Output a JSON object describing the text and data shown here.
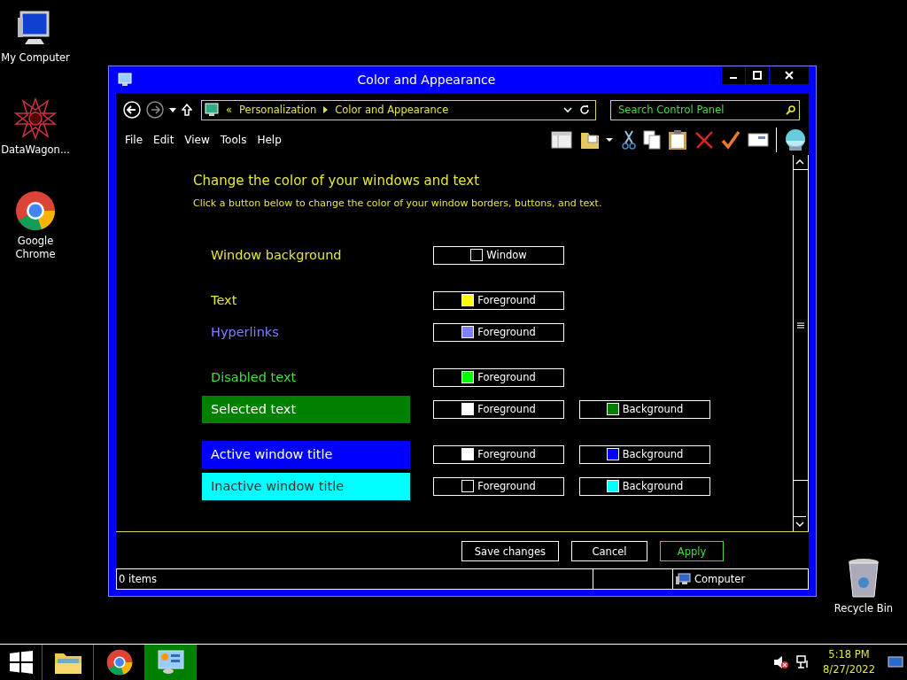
{
  "desktop_icons": [
    {
      "label": "My Computer",
      "kind": "computer"
    },
    {
      "label": "DataWagon...",
      "kind": "star"
    },
    {
      "label": "Google Chrome",
      "kind": "chrome"
    },
    {
      "label": "Recycle Bin",
      "kind": "bin"
    }
  ],
  "window": {
    "title": "Color and Appearance"
  },
  "address": {
    "crumbs": [
      "«",
      "Personalization",
      "Color and Appearance"
    ]
  },
  "search": {
    "placeholder": "Search Control Panel"
  },
  "menu": [
    "File",
    "Edit",
    "View",
    "Tools",
    "Help"
  ],
  "heading": "Change the color of your windows and text",
  "subheading": "Click a button below to change the color of your window borders, buttons, and text.",
  "groups": [
    {
      "rows": [
        {
          "label": "Window background",
          "kind": "plain",
          "color": "#e6e63a",
          "swatches": [
            {
              "label": "Window",
              "color": "#000000"
            }
          ]
        }
      ]
    },
    {
      "rows": [
        {
          "label": "Text",
          "kind": "plain",
          "color": "#e6e63a",
          "swatches": [
            {
              "label": "Foreground",
              "color": "#ffff00"
            }
          ]
        },
        {
          "label": "Hyperlinks",
          "kind": "plain",
          "color": "#8080ff",
          "swatches": [
            {
              "label": "Foreground",
              "color": "#8080ff"
            }
          ]
        }
      ]
    },
    {
      "rows": [
        {
          "label": "Disabled text",
          "kind": "plain",
          "color": "#3fdf3f",
          "swatches": [
            {
              "label": "Foreground",
              "color": "#00ff00"
            }
          ]
        },
        {
          "label": "Selected text",
          "kind": "band",
          "color": "#008000",
          "swatches": [
            {
              "label": "Foreground",
              "color": "#ffffff"
            },
            {
              "label": "Background",
              "color": "#008000"
            }
          ]
        }
      ]
    },
    {
      "rows": [
        {
          "label": "Active window title",
          "kind": "band",
          "color": "#0000ff",
          "swatches": [
            {
              "label": "Foreground",
              "color": "#ffffff"
            },
            {
              "label": "Background",
              "color": "#0000ff"
            }
          ]
        },
        {
          "label": "Inactive window title",
          "kind": "band",
          "color": "#00ffff",
          "swatches": [
            {
              "label": "Foreground",
              "color": "#000000"
            },
            {
              "label": "Background",
              "color": "#00ffff"
            }
          ]
        }
      ]
    }
  ],
  "buttons": [
    {
      "label": "Save changes",
      "kind": "normal"
    },
    {
      "label": "Cancel",
      "kind": "normal"
    },
    {
      "label": "Apply",
      "kind": "accent"
    }
  ],
  "status_bar": {
    "items": "0 items",
    "location": "Computer"
  },
  "taskbar": {
    "apps": [
      {
        "kind": "explorer",
        "selected": false
      },
      {
        "kind": "chrome",
        "selected": false
      },
      {
        "kind": "control",
        "selected": true
      }
    ],
    "time": "5:18 PM",
    "date": "8/27/2022"
  }
}
